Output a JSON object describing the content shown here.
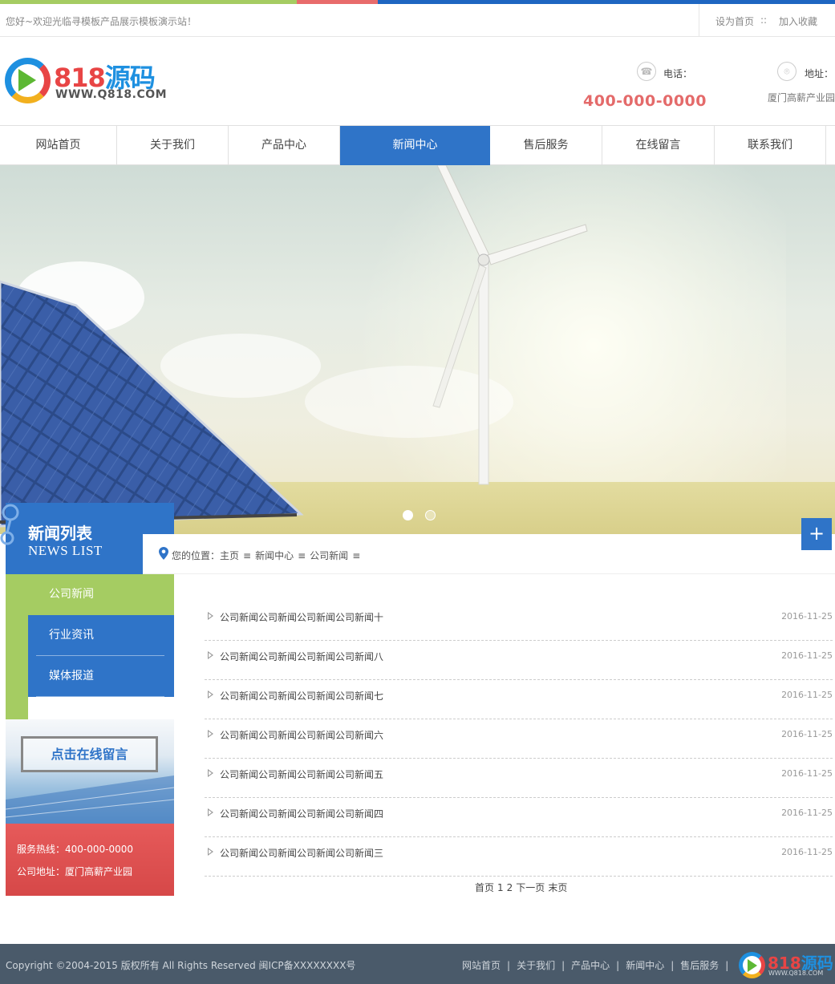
{
  "colors": {
    "accent_blue": "#2f74c8",
    "accent_green": "#a5cc62",
    "accent_red": "#e46a6a",
    "footer_bg": "#4a5a6a"
  },
  "topbar": {
    "welcome": "您好~欢迎光临寻模板产品展示模板演示站！",
    "set_home": "设为首页",
    "separator": "::",
    "bookmark": "加入收藏"
  },
  "header": {
    "logo_number": "818",
    "logo_text": "源码",
    "logo_url": "WWW.Q818.COM",
    "phone_label": "电话：",
    "phone": "400-000-0000",
    "address_label": "地址：",
    "address": "厦门高薪产业园"
  },
  "nav": {
    "items": [
      {
        "label": "网站首页"
      },
      {
        "label": "关于我们"
      },
      {
        "label": "产品中心"
      },
      {
        "label": "新闻中心"
      },
      {
        "label": "售后服务"
      },
      {
        "label": "在线留言"
      },
      {
        "label": "联系我们"
      }
    ],
    "active_index": 3
  },
  "sidebar": {
    "title": "新闻列表",
    "subtitle": "NEWS LIST",
    "items": [
      {
        "label": "公司新闻"
      },
      {
        "label": "行业资讯"
      },
      {
        "label": "媒体报道"
      }
    ],
    "promo_button": "点击在线留言",
    "hotline": "服务热线：400-000-0000",
    "address": "公司地址：厦门高薪产业园"
  },
  "breadcrumb": {
    "label": "您的位置：",
    "home": "主页",
    "sep": "≡",
    "section": "新闻中心",
    "current": "公司新闻"
  },
  "plus": "+",
  "news": [
    {
      "title": "公司新闻公司新闻公司新闻公司新闻十",
      "date": "2016-11-25"
    },
    {
      "title": "公司新闻公司新闻公司新闻公司新闻八",
      "date": "2016-11-25"
    },
    {
      "title": "公司新闻公司新闻公司新闻公司新闻七",
      "date": "2016-11-25"
    },
    {
      "title": "公司新闻公司新闻公司新闻公司新闻六",
      "date": "2016-11-25"
    },
    {
      "title": "公司新闻公司新闻公司新闻公司新闻五",
      "date": "2016-11-25"
    },
    {
      "title": "公司新闻公司新闻公司新闻公司新闻四",
      "date": "2016-11-25"
    },
    {
      "title": "公司新闻公司新闻公司新闻公司新闻三",
      "date": "2016-11-25"
    }
  ],
  "pager": {
    "first": "首页",
    "p1": "1",
    "p2": "2",
    "next": "下一页",
    "last": "末页"
  },
  "footer": {
    "copyright": "Copyright ©2004-2015 版权所有 All Rights Reserved 闽ICP备XXXXXXXX号",
    "links": [
      {
        "label": "网站首页"
      },
      {
        "label": "关于我们"
      },
      {
        "label": "产品中心"
      },
      {
        "label": "新闻中心"
      },
      {
        "label": "售后服务"
      }
    ],
    "sep": "|",
    "logo_number": "818",
    "logo_text": "源码",
    "logo_url": "WWW.Q818.COM"
  }
}
